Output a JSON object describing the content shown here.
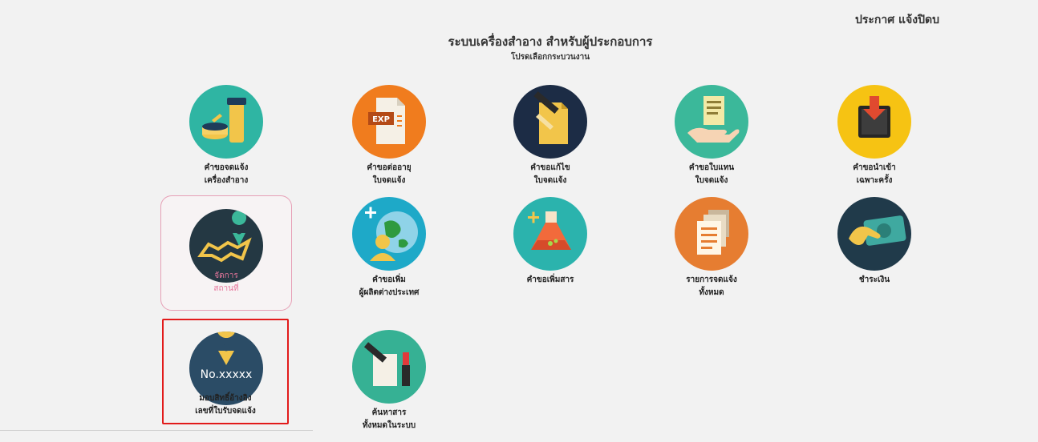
{
  "header": {
    "announce": "ประกาศ แจ้งปิดบ",
    "title": "ระบบเครื่องสำอาง สำหรับผู้ประกอบการ",
    "subtitle": "โปรดเลือกกระบวนงาน"
  },
  "tiles": [
    {
      "line1": "คำขอจดแจ้ง",
      "line2": "เครื่องสำอาง",
      "icon": "cosmetics-icon",
      "color": "#2fb5a3"
    },
    {
      "line1": "คำขอต่ออายุ",
      "line2": "ใบจดแจ้ง",
      "icon": "renewal-exp-icon",
      "color": "#f07c1e",
      "badge": "EXP"
    },
    {
      "line1": "คำขอแก้ไข",
      "line2": "ใบจดแจ้ง",
      "icon": "edit-document-icon",
      "color": "#1c2c45"
    },
    {
      "line1": "คำขอใบแทน",
      "line2": "ใบจดแจ้ง",
      "icon": "replacement-document-icon",
      "color": "#3bb89a"
    },
    {
      "line1": "คำขอนำเข้า",
      "line2": "เฉพาะครั้ง",
      "icon": "import-box-icon",
      "color": "#f6c313"
    },
    {
      "line1": "จัดการ",
      "line2": "สถานที่",
      "icon": "location-map-icon",
      "color": "#243843"
    },
    {
      "line1": "คำขอเพิ่ม",
      "line2": "ผู้ผลิตต่างประเทศ",
      "icon": "foreign-manufacturer-icon",
      "color": "#1ea9c8"
    },
    {
      "line1": "คำขอเพิ่มสาร",
      "line2": "",
      "icon": "chemical-flask-icon",
      "color": "#2bb3ad"
    },
    {
      "line1": "รายการจดแจ้ง",
      "line2": "ทั้งหมด",
      "icon": "document-list-icon",
      "color": "#e67d31"
    },
    {
      "line1": "ชำระเงิน",
      "line2": "",
      "icon": "payment-icon",
      "color": "#203a4a"
    },
    {
      "line1": "มอบสิทธิ์อ้างอิง",
      "line2": "เลขที่ใบรับจดแจ้ง",
      "icon": "reference-number-icon",
      "color": "#2b4c66",
      "badge": "No.xxxxx"
    },
    {
      "line1": "ค้นหาสาร",
      "line2": "ทั้งหมดในระบบ",
      "icon": "search-substance-icon",
      "color": "#36b194"
    }
  ]
}
